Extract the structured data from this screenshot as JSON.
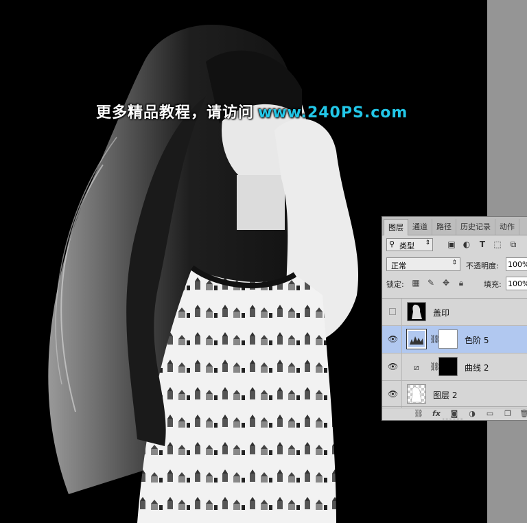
{
  "watermark": {
    "text": "更多精品教程，请访问",
    "url": "www.240PS.com"
  },
  "panel": {
    "tabs": [
      {
        "label": "图层",
        "active": true
      },
      {
        "label": "通道",
        "active": false
      },
      {
        "label": "路径",
        "active": false
      },
      {
        "label": "历史记录",
        "active": false
      },
      {
        "label": "动作",
        "active": false
      }
    ],
    "filter": {
      "kind_label": "类型",
      "icons": [
        "image-filter-icon",
        "adjustment-filter-icon",
        "type-filter-icon",
        "shape-filter-icon",
        "smart-object-filter-icon"
      ]
    },
    "blend_mode": "正常",
    "opacity_label": "不透明度:",
    "opacity_value": "100%",
    "lock_label": "锁定:",
    "fill_label": "填充:",
    "fill_value": "100%",
    "layers": [
      {
        "name": "盖印",
        "visible": false,
        "selected": false,
        "type": "pixel"
      },
      {
        "name": "色阶 5",
        "visible": true,
        "selected": true,
        "type": "levels-adjustment"
      },
      {
        "name": "曲线 2",
        "visible": true,
        "selected": false,
        "type": "curves-adjustment"
      },
      {
        "name": "图层 2",
        "visible": true,
        "selected": false,
        "type": "pixel"
      }
    ],
    "bottom_icons": [
      "link-icon",
      "fx-icon",
      "mask-icon",
      "adjustment-icon",
      "folder-icon",
      "new-layer-icon",
      "trash-icon"
    ],
    "colors": {
      "selected_row": "#b1c8f0",
      "panel_bg": "#d6d6d6",
      "watermark_url": "#22c7e8"
    }
  }
}
